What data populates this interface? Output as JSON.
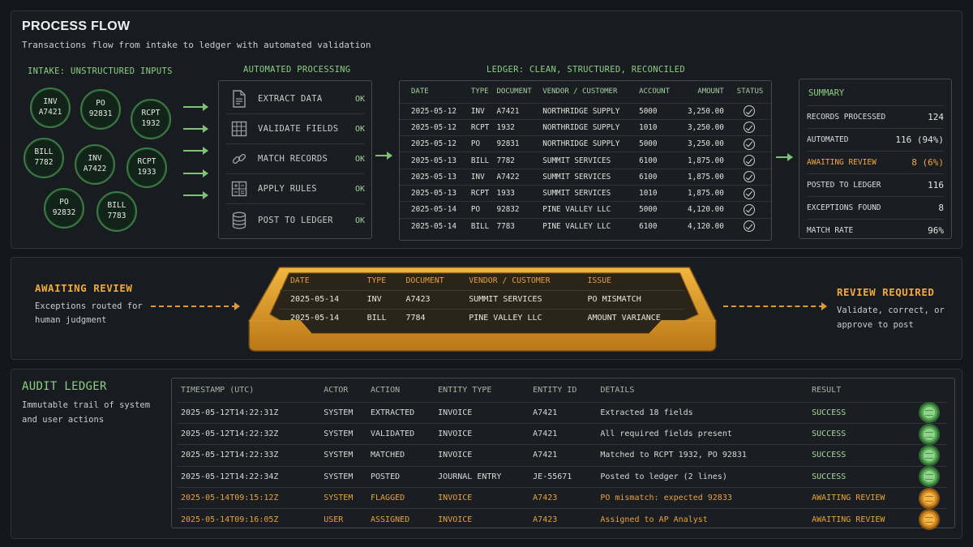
{
  "process": {
    "title": "PROCESS FLOW",
    "subtitle": "Transactions flow from intake to ledger with automated validation",
    "intake_header": "INTAKE: UNSTRUCTURED INPUTS",
    "processing_header": "AUTOMATED PROCESSING",
    "ledger_header": "LEDGER: CLEAN, STRUCTURED, RECONCILED",
    "intake_docs": [
      {
        "type": "INV",
        "id": "A7421"
      },
      {
        "type": "PO",
        "id": "92831"
      },
      {
        "type": "RCPT",
        "id": "1932"
      },
      {
        "type": "BILL",
        "id": "7782"
      },
      {
        "type": "INV",
        "id": "A7422"
      },
      {
        "type": "RCPT",
        "id": "1933"
      },
      {
        "type": "PO",
        "id": "92832"
      },
      {
        "type": "BILL",
        "id": "7783"
      }
    ],
    "steps": [
      {
        "label": "EXTRACT DATA",
        "status": "OK",
        "icon": "document-icon"
      },
      {
        "label": "VALIDATE FIELDS",
        "status": "OK",
        "icon": "grid-icon"
      },
      {
        "label": "MATCH RECORDS",
        "status": "OK",
        "icon": "link-icon"
      },
      {
        "label": "APPLY RULES",
        "status": "OK",
        "icon": "calculator-icon"
      },
      {
        "label": "POST TO LEDGER",
        "status": "OK",
        "icon": "database-icon"
      }
    ],
    "ledger": {
      "columns": [
        "DATE",
        "TYPE",
        "DOCUMENT",
        "VENDOR / CUSTOMER",
        "ACCOUNT",
        "AMOUNT",
        "STATUS"
      ],
      "rows": [
        [
          "2025-05-12",
          "INV",
          "A7421",
          "NORTHRIDGE SUPPLY",
          "5000",
          "3,250.00"
        ],
        [
          "2025-05-12",
          "RCPT",
          "1932",
          "NORTHRIDGE SUPPLY",
          "1010",
          "3,250.00"
        ],
        [
          "2025-05-12",
          "PO",
          "92831",
          "NORTHRIDGE SUPPLY",
          "5000",
          "3,250.00"
        ],
        [
          "2025-05-13",
          "BILL",
          "7782",
          "SUMMIT SERVICES",
          "6100",
          "1,875.00"
        ],
        [
          "2025-05-13",
          "INV",
          "A7422",
          "SUMMIT SERVICES",
          "6100",
          "1,875.00"
        ],
        [
          "2025-05-13",
          "RCPT",
          "1933",
          "SUMMIT SERVICES",
          "1010",
          "1,875.00"
        ],
        [
          "2025-05-14",
          "PO",
          "92832",
          "PINE VALLEY LLC",
          "5000",
          "4,120.00"
        ],
        [
          "2025-05-14",
          "BILL",
          "7783",
          "PINE VALLEY LLC",
          "6100",
          "4,120.00"
        ]
      ],
      "status_icon": "check-circle-icon"
    },
    "summary": {
      "title": "SUMMARY",
      "rows": [
        {
          "label": "RECORDS PROCESSED",
          "value": "124"
        },
        {
          "label": "AUTOMATED",
          "value": "116 (94%)"
        },
        {
          "label": "AWAITING REVIEW",
          "value": "8 (6%)"
        },
        {
          "label": "POSTED TO LEDGER",
          "value": "116"
        },
        {
          "label": "EXCEPTIONS FOUND",
          "value": "8"
        },
        {
          "label": "MATCH RATE",
          "value": "96%"
        }
      ]
    }
  },
  "review": {
    "title": "AWAITING REVIEW",
    "subtitle": "Exceptions routed for human judgment",
    "tray": {
      "columns": [
        "DATE",
        "TYPE",
        "DOCUMENT",
        "VENDOR / CUSTOMER",
        "ISSUE"
      ],
      "rows": [
        [
          "2025-05-14",
          "INV",
          "A7423",
          "SUMMIT SERVICES",
          "PO MISMATCH"
        ],
        [
          "2025-05-14",
          "BILL",
          "7784",
          "PINE VALLEY LLC",
          "AMOUNT VARIANCE"
        ]
      ]
    },
    "required_title": "REVIEW REQUIRED",
    "required_sub": "Validate, correct, or approve to post"
  },
  "audit": {
    "title": "AUDIT LEDGER",
    "subtitle": "Immutable trail of system and user actions",
    "columns": [
      "TIMESTAMP (UTC)",
      "ACTOR",
      "ACTION",
      "ENTITY TYPE",
      "ENTITY ID",
      "DETAILS",
      "RESULT"
    ],
    "rows": [
      {
        "cells": [
          "2025-05-12T14:22:31Z",
          "SYSTEM",
          "EXTRACTED",
          "INVOICE",
          "A7421",
          "Extracted 18 fields",
          "SUCCESS"
        ],
        "state": "success"
      },
      {
        "cells": [
          "2025-05-12T14:22:32Z",
          "SYSTEM",
          "VALIDATED",
          "INVOICE",
          "A7421",
          "All required fields present",
          "SUCCESS"
        ],
        "state": "success"
      },
      {
        "cells": [
          "2025-05-12T14:22:33Z",
          "SYSTEM",
          "MATCHED",
          "INVOICE",
          "A7421",
          "Matched to RCPT 1932, PO 92831",
          "SUCCESS"
        ],
        "state": "success"
      },
      {
        "cells": [
          "2025-05-12T14:22:34Z",
          "SYSTEM",
          "POSTED",
          "JOURNAL ENTRY",
          "JE-55671",
          "Posted to ledger (2 lines)",
          "SUCCESS"
        ],
        "state": "success"
      },
      {
        "cells": [
          "2025-05-14T09:15:12Z",
          "SYSTEM",
          "FLAGGED",
          "INVOICE",
          "A7423",
          "PO mismatch: expected 92833",
          "AWAITING REVIEW"
        ],
        "state": "review"
      },
      {
        "cells": [
          "2025-05-14T09:16:05Z",
          "USER",
          "ASSIGNED",
          "INVOICE",
          "A7423",
          "Assigned to AP Analyst",
          "AWAITING REVIEW"
        ],
        "state": "review"
      }
    ]
  },
  "colors": {
    "accent_green": "#8ccf83",
    "accent_amber": "#f0a93a",
    "background": "#14171b"
  }
}
